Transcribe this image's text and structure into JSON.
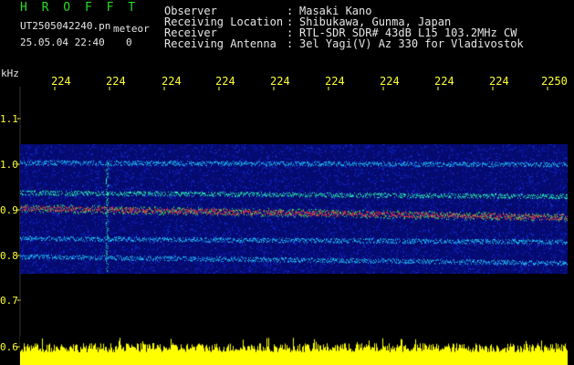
{
  "header": {
    "app_title": "H R O F F T",
    "filename": "UT2505042240.pn",
    "meteor_label": "meteor",
    "datetime": "25.05.04 22:40",
    "count": "0"
  },
  "info": [
    {
      "label": "Observer",
      "value": "Masaki Kano"
    },
    {
      "label": "Receiving Location",
      "value": "Shibukawa, Gunma, Japan"
    },
    {
      "label": "Receiver",
      "value": "RTL-SDR SDR# 43dB L15 103.2MHz CW"
    },
    {
      "label": "Receiving Antenna",
      "value": "3el Yagi(V) Az 330 for Vladivostok"
    }
  ],
  "axes": {
    "unit_label": "kHz",
    "x_ticks": [
      "224",
      "224",
      "224",
      "224",
      "224",
      "224",
      "224",
      "224",
      "224",
      "2250"
    ],
    "y_ticks": [
      "1.1",
      "1.0",
      "0.9",
      "0.8",
      "0.7",
      "0.6"
    ]
  },
  "colors": {
    "background": "#000000",
    "waterfall": "#050a6e",
    "tick_text": "#ffff33",
    "title": "#22dd22",
    "spectrum": "#ffff00"
  }
}
